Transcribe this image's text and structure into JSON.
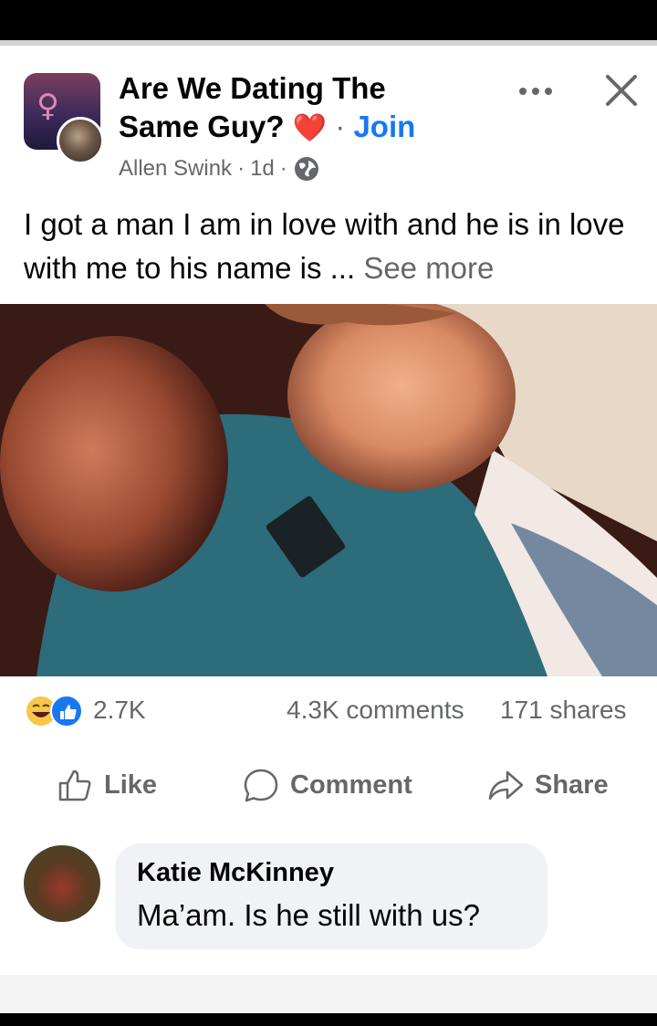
{
  "group": {
    "name": "Are We Dating The Same Guy?",
    "heart": "❤️",
    "separator": "·",
    "join_label": "Join"
  },
  "post": {
    "author": "Allen Swink",
    "time": "1d",
    "text": "I got a man I am in love with and he is in love with me to his name is ...",
    "see_more": "See more"
  },
  "stats": {
    "reactions": "2.7K",
    "comments": "4.3K comments",
    "shares": "171 shares"
  },
  "actions": {
    "like": "Like",
    "comment": "Comment",
    "share": "Share"
  },
  "comment": {
    "author": "Katie McKinney",
    "text": "Ma’am. Is he still with us?"
  },
  "icons": {
    "more": "more-horizontal-icon",
    "close": "close-icon",
    "globe": "globe-icon",
    "haha": "haha-reaction-icon",
    "like": "like-reaction-icon"
  },
  "colors": {
    "accent": "#1877f2",
    "secondary_text": "#65676b",
    "heart": "#e0283f"
  }
}
